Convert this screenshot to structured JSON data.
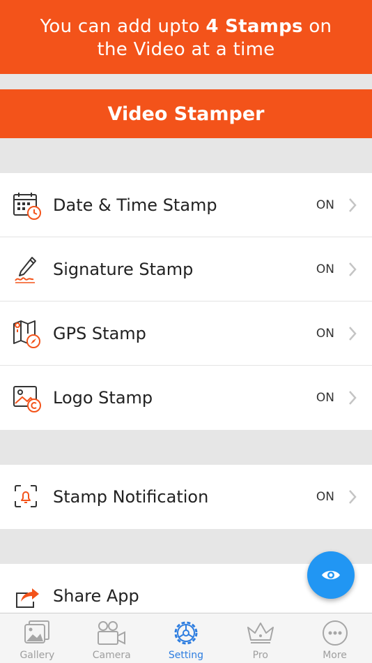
{
  "promo": {
    "line1_pre": "You can add upto ",
    "line1_bold": "4 Stamps",
    "line1_post": " on",
    "line2": "the Video at a time"
  },
  "header": {
    "title": "Video Stamper"
  },
  "stamps": [
    {
      "label": "Date & Time Stamp",
      "value": "ON",
      "icon": "calendar-clock-icon"
    },
    {
      "label": "Signature Stamp",
      "value": "ON",
      "icon": "pen-signature-icon"
    },
    {
      "label": "GPS Stamp",
      "value": "ON",
      "icon": "map-compass-icon"
    },
    {
      "label": "Logo Stamp",
      "value": "ON",
      "icon": "image-copyright-icon"
    }
  ],
  "notification": {
    "label": "Stamp Notification",
    "value": "ON",
    "icon": "bell-frame-icon"
  },
  "share": {
    "label": "Share App",
    "icon": "share-arrow-icon"
  },
  "fab": {
    "icon": "eye-icon"
  },
  "tabs": [
    {
      "label": "Gallery",
      "icon": "gallery-icon"
    },
    {
      "label": "Camera",
      "icon": "video-camera-icon"
    },
    {
      "label": "Setting",
      "icon": "gear-icon"
    },
    {
      "label": "Pro",
      "icon": "crown-icon"
    },
    {
      "label": "More",
      "icon": "more-dots-icon"
    }
  ],
  "colors": {
    "accent": "#f3531a",
    "fab": "#2196f3",
    "active_tab": "#2d7de0"
  }
}
